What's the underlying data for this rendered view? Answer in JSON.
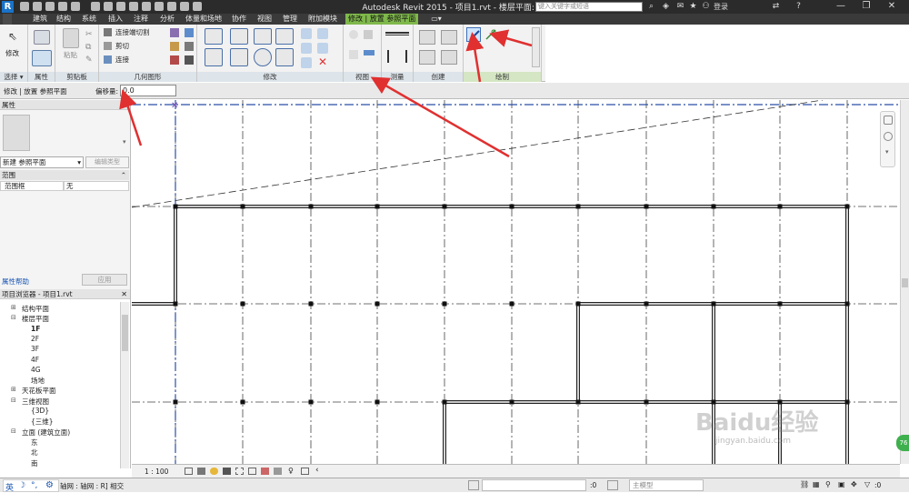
{
  "app": {
    "title": "Autodesk Revit 2015 -    项目1.rvt - 楼层平面: 1F",
    "logo_letter": "R",
    "search_placeholder": "键入关键字或短语",
    "login_label": "登录"
  },
  "menu_tabs": [
    {
      "label": "建筑"
    },
    {
      "label": "结构"
    },
    {
      "label": "系统"
    },
    {
      "label": "插入"
    },
    {
      "label": "注释"
    },
    {
      "label": "分析"
    },
    {
      "label": "体量和场地"
    },
    {
      "label": "协作"
    },
    {
      "label": "视图"
    },
    {
      "label": "管理"
    },
    {
      "label": "附加模块"
    },
    {
      "label": "修改 | 放置 参照平面"
    }
  ],
  "ribbon": {
    "modify_label": "修改",
    "panels": [
      {
        "label": "选择 ▾"
      },
      {
        "label": "属性"
      },
      {
        "label": "剪贴板"
      },
      {
        "label": "几何图形"
      },
      {
        "label": "修改"
      },
      {
        "label": "视图"
      },
      {
        "label": "测量"
      },
      {
        "label": "创建"
      },
      {
        "label": "绘制"
      }
    ],
    "geometry_items": [
      "连接端切割",
      "剪切",
      "连接"
    ],
    "clipboard_paste": "粘贴"
  },
  "options_bar": {
    "context_label": "修改 | 放置 参照平面",
    "offset_label": "偏移量:",
    "offset_value": "0.0"
  },
  "properties": {
    "title": "属性",
    "type_selector": "新建 参照平面",
    "edit_type_label": "编辑类型",
    "section": "范围",
    "param_name": "范围框",
    "param_value": "无",
    "help_link": "属性帮助",
    "apply_label": "应用"
  },
  "project_browser": {
    "title": "项目浏览器 - 项目1.rvt",
    "items": [
      {
        "label": "结构平面",
        "level": 1,
        "expander": "⊞"
      },
      {
        "label": "楼层平面",
        "level": 1,
        "expander": "⊟"
      },
      {
        "label": "1F",
        "level": 2,
        "expander": ""
      },
      {
        "label": "2F",
        "level": 2,
        "expander": ""
      },
      {
        "label": "3F",
        "level": 2,
        "expander": ""
      },
      {
        "label": "4F",
        "level": 2,
        "expander": ""
      },
      {
        "label": "4G",
        "level": 2,
        "expander": ""
      },
      {
        "label": "场地",
        "level": 2,
        "expander": ""
      },
      {
        "label": "天花板平面",
        "level": 1,
        "expander": "⊞"
      },
      {
        "label": "三维视图",
        "level": 1,
        "expander": "⊟"
      },
      {
        "label": "{3D}",
        "level": 2,
        "expander": ""
      },
      {
        "label": "{三维}",
        "level": 2,
        "expander": ""
      },
      {
        "label": "立面 (建筑立面)",
        "level": 1,
        "expander": "⊟"
      },
      {
        "label": "东",
        "level": 2,
        "expander": ""
      },
      {
        "label": "北",
        "level": 2,
        "expander": ""
      },
      {
        "label": "南",
        "level": 2,
        "expander": ""
      }
    ]
  },
  "view_bar": {
    "scale": "1 : 100"
  },
  "statusbar": {
    "ime": "英",
    "message": "轴网 : 轴网 : R] 相交",
    "workset_value": ":0",
    "model_label": "主模型",
    "filter_value": ":0"
  },
  "watermark": {
    "brand": "Baidu经验",
    "url": "jingyan.baidu.com"
  },
  "colors": {
    "active_tab": "#7fb84b",
    "title_bar": "#2b2b2b",
    "annotation_arrow": "#e03030",
    "ref_line": "#2a4fa8"
  }
}
